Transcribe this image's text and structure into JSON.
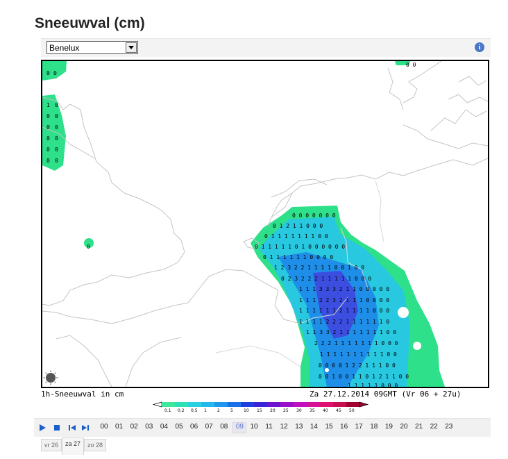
{
  "title": "Sneeuwval (cm)",
  "region_select": {
    "value": "Benelux"
  },
  "info_icon": "i",
  "map": {
    "caption_left": "1h-Sneeuwval in cm",
    "caption_right": "Za 27.12.2014 09GMT (Vr 06 + 27u)",
    "snow_color_light": "#2ee08a",
    "snow_color_mid": "#28c8e0",
    "snow_color_blue": "#1e8ee8",
    "snow_color_deep": "#3b4ee0"
  },
  "legend": {
    "labels": [
      "0.1",
      "0.2",
      "0.5",
      "1",
      "2",
      "5",
      "10",
      "15",
      "20",
      "25",
      "30",
      "35",
      "40",
      "45",
      "50"
    ],
    "colors": [
      "#3ee89a",
      "#2ee0b8",
      "#28d0e0",
      "#22b8ec",
      "#1e98ec",
      "#1a70e8",
      "#1e3ee0",
      "#3a24d8",
      "#6a14d0",
      "#9a10c8",
      "#c010c0",
      "#d81098",
      "#e01070",
      "#c81050",
      "#a00030"
    ]
  },
  "controls": {
    "hours": [
      "00",
      "01",
      "02",
      "03",
      "04",
      "05",
      "06",
      "07",
      "08",
      "09",
      "10",
      "11",
      "12",
      "13",
      "14",
      "15",
      "16",
      "17",
      "18",
      "19",
      "20",
      "21",
      "22",
      "23"
    ],
    "active_hour": "09"
  },
  "days": [
    {
      "label": "vr 26",
      "active": false
    },
    {
      "label": "za 27",
      "active": true
    },
    {
      "label": "zo 28",
      "active": false
    }
  ]
}
